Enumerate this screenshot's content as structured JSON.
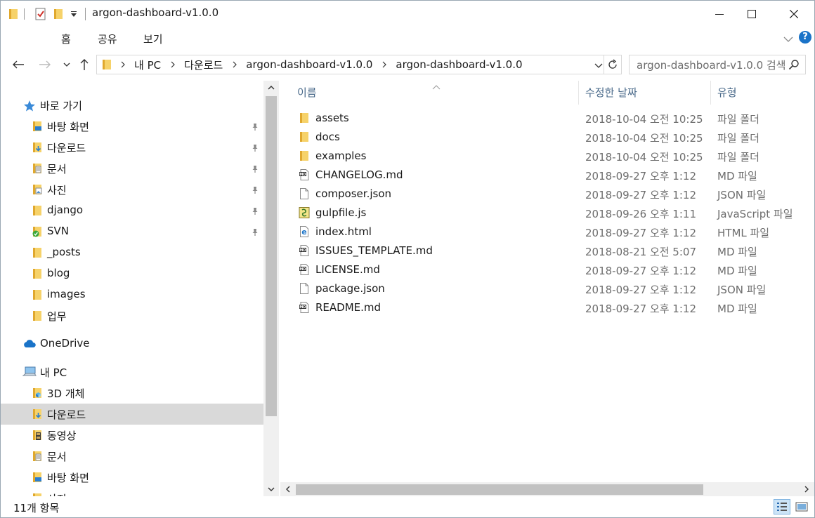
{
  "window": {
    "title": "argon-dashboard-v1.0.0"
  },
  "ribbon": {
    "tabs": [
      "홈",
      "공유",
      "보기"
    ]
  },
  "address": {
    "crumbs": [
      "내 PC",
      "다운로드",
      "argon-dashboard-v1.0.0",
      "argon-dashboard-v1.0.0"
    ],
    "search_placeholder": "argon-dashboard-v1.0.0 검색"
  },
  "nav": {
    "quick_access": "바로 가기",
    "quick_items": [
      {
        "label": "바탕 화면",
        "icon": "desktop-folder-icon",
        "pinned": true
      },
      {
        "label": "다운로드",
        "icon": "downloads-folder-icon",
        "pinned": true
      },
      {
        "label": "문서",
        "icon": "documents-folder-icon",
        "pinned": true
      },
      {
        "label": "사진",
        "icon": "pictures-folder-icon",
        "pinned": true
      },
      {
        "label": "django",
        "icon": "folder-icon",
        "pinned": true
      },
      {
        "label": "SVN",
        "icon": "svn-folder-icon",
        "pinned": true
      },
      {
        "label": "_posts",
        "icon": "folder-icon",
        "pinned": false
      },
      {
        "label": "blog",
        "icon": "folder-icon",
        "pinned": false
      },
      {
        "label": "images",
        "icon": "folder-icon",
        "pinned": false
      },
      {
        "label": "업무",
        "icon": "folder-icon",
        "pinned": false
      }
    ],
    "onedrive": "OneDrive",
    "this_pc": "내 PC",
    "pc_items": [
      {
        "label": "3D 개체",
        "icon": "3d-objects-folder-icon"
      },
      {
        "label": "다운로드",
        "icon": "downloads-folder-icon",
        "selected": true
      },
      {
        "label": "동영상",
        "icon": "videos-folder-icon"
      },
      {
        "label": "문서",
        "icon": "documents-folder-icon"
      },
      {
        "label": "바탕 화면",
        "icon": "desktop-folder-icon"
      },
      {
        "label": "사진",
        "icon": "pictures-folder-icon"
      }
    ]
  },
  "columns": {
    "name": "이름",
    "date": "수정한 날짜",
    "type": "유형"
  },
  "files": [
    {
      "name": "assets",
      "date": "2018-10-04 오전 10:25",
      "type": "파일 폴더",
      "icon": "folder-icon"
    },
    {
      "name": "docs",
      "date": "2018-10-04 오전 10:25",
      "type": "파일 폴더",
      "icon": "folder-icon"
    },
    {
      "name": "examples",
      "date": "2018-10-04 오전 10:25",
      "type": "파일 폴더",
      "icon": "folder-icon"
    },
    {
      "name": "CHANGELOG.md",
      "date": "2018-09-27 오후 1:12",
      "type": "MD 파일",
      "icon": "md-file-icon"
    },
    {
      "name": "composer.json",
      "date": "2018-09-27 오후 1:12",
      "type": "JSON 파일",
      "icon": "blank-file-icon"
    },
    {
      "name": "gulpfile.js",
      "date": "2018-09-26 오후 1:11",
      "type": "JavaScript 파일",
      "icon": "js-file-icon"
    },
    {
      "name": "index.html",
      "date": "2018-09-27 오후 1:12",
      "type": "HTML 파일",
      "icon": "edge-html-file-icon"
    },
    {
      "name": "ISSUES_TEMPLATE.md",
      "date": "2018-08-21 오전 5:07",
      "type": "MD 파일",
      "icon": "md-file-icon"
    },
    {
      "name": "LICENSE.md",
      "date": "2018-09-27 오후 1:12",
      "type": "MD 파일",
      "icon": "md-file-icon"
    },
    {
      "name": "package.json",
      "date": "2018-09-27 오후 1:12",
      "type": "JSON 파일",
      "icon": "blank-file-icon"
    },
    {
      "name": "README.md",
      "date": "2018-09-27 오후 1:12",
      "type": "MD 파일",
      "icon": "md-file-icon"
    }
  ],
  "status": {
    "item_count": "11개 항목"
  },
  "colors": {
    "selection": "#d9d9d9",
    "header_text": "#4a6a8a",
    "secondary_text": "#6d6d6d",
    "folder_yellow": "#f6d26a",
    "help_blue": "#1a73c8"
  }
}
